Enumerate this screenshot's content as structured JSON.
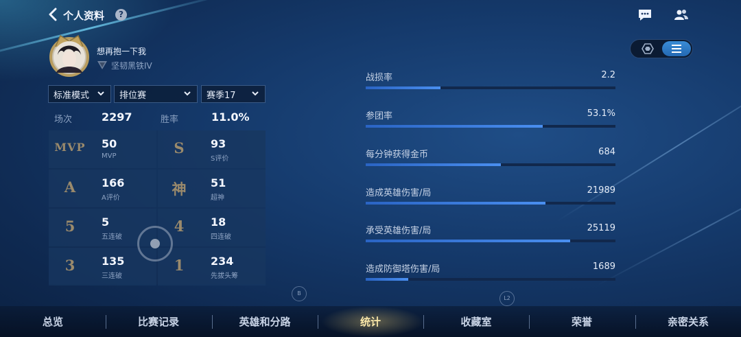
{
  "header": {
    "title": "个人资料",
    "help": "?"
  },
  "player": {
    "name": "想再抱一下我",
    "rank": "坚韧黑铁IV"
  },
  "filters": [
    {
      "label": "标准模式"
    },
    {
      "label": "排位赛"
    },
    {
      "label": "赛季17"
    }
  ],
  "summary": {
    "matches_label": "场次",
    "matches": "2297",
    "winrate_label": "胜率",
    "winrate": "11.0%"
  },
  "grid": [
    {
      "badge": "MVP",
      "value": "50",
      "sub": "MVP"
    },
    {
      "badge": "S",
      "value": "93",
      "sub": "S评价"
    },
    {
      "badge": "A",
      "value": "166",
      "sub": "A评价"
    },
    {
      "badge": "神",
      "value": "51",
      "sub": "超神"
    },
    {
      "badge": "5",
      "value": "5",
      "sub": "五连破"
    },
    {
      "badge": "4",
      "value": "18",
      "sub": "四连破"
    },
    {
      "badge": "3",
      "value": "135",
      "sub": "三连破"
    },
    {
      "badge": "1",
      "value": "234",
      "sub": "先拔头筹"
    }
  ],
  "controls": {
    "b": "B",
    "l2": "L2"
  },
  "stats": [
    {
      "label": "战损率",
      "value": "2.2",
      "fill": 0.3
    },
    {
      "label": "参团率",
      "value": "53.1%",
      "fill": 0.71
    },
    {
      "label": "每分钟获得金币",
      "value": "684",
      "fill": 0.54
    },
    {
      "label": "造成英雄伤害/局",
      "value": "21989",
      "fill": 0.72
    },
    {
      "label": "承受英雄伤害/局",
      "value": "25119",
      "fill": 0.82
    },
    {
      "label": "造成防御塔伤害/局",
      "value": "1689",
      "fill": 0.17
    }
  ],
  "nav": [
    {
      "label": "总览"
    },
    {
      "label": "比赛记录"
    },
    {
      "label": "英雄和分路"
    },
    {
      "label": "统计",
      "active": true
    },
    {
      "label": "收藏室"
    },
    {
      "label": "荣誉"
    },
    {
      "label": "亲密关系"
    }
  ],
  "colors": {
    "accent": "#3a8cd6",
    "active_nav": "#f8e6a8",
    "badge": "#9a8a6c"
  },
  "icons": [
    "back-arrow-icon",
    "help-icon",
    "chat-icon",
    "friends-icon",
    "hexagon-view-icon",
    "list-view-icon",
    "rank-icon",
    "chevron-down-icon"
  ]
}
